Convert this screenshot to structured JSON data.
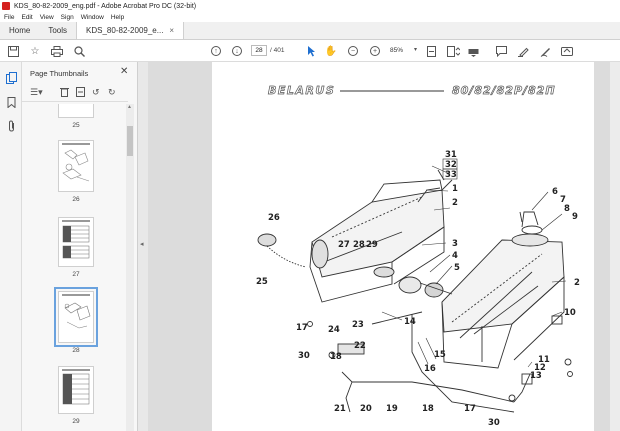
{
  "window": {
    "title": "KDS_80-82-2009_eng.pdf - Adobe Acrobat Pro DC (32-bit)"
  },
  "menu": {
    "items": [
      "File",
      "Edit",
      "View",
      "Sign",
      "Window",
      "Help"
    ]
  },
  "tabs": {
    "home": "Home",
    "tools": "Tools",
    "document": "KDS_80-82-2009_e...",
    "close_glyph": "×"
  },
  "toolbar": {
    "current_page": "28",
    "total_pages": "/ 401",
    "zoom": "85%"
  },
  "thumbnails_panel": {
    "title": "Page Thumbnails",
    "close_glyph": "✕",
    "items": [
      {
        "label": "25"
      },
      {
        "label": "26"
      },
      {
        "label": "27"
      },
      {
        "label": "28",
        "selected": true
      },
      {
        "label": "29"
      }
    ]
  },
  "document": {
    "header_left": "BELARUS",
    "header_right": "80/82/82P/82П",
    "callouts": [
      "31",
      "32",
      "33",
      "1",
      "2",
      "3",
      "4",
      "5",
      "6",
      "7",
      "8",
      "9",
      "26",
      "27",
      "28",
      "29",
      "25",
      "2",
      "10",
      "14",
      "17",
      "24",
      "23",
      "22",
      "18",
      "30",
      "15",
      "16",
      "11",
      "12",
      "13",
      "21",
      "20",
      "19",
      "18",
      "17",
      "30"
    ]
  },
  "colors": {
    "accent": "#1f6fd0",
    "adobe_red": "#d4211e",
    "selection_outline": "#6aa2de"
  }
}
